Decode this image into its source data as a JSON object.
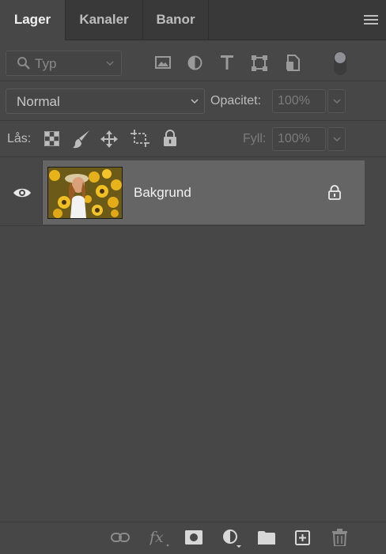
{
  "tabs": [
    {
      "label": "Lager",
      "active": true
    },
    {
      "label": "Kanaler",
      "active": false
    },
    {
      "label": "Banor",
      "active": false
    }
  ],
  "filter": {
    "kind_label": "Typ",
    "icons": [
      "image-filter-icon",
      "adjustment-filter-icon",
      "text-filter-icon",
      "shape-filter-icon",
      "smart-object-filter-icon"
    ]
  },
  "blend": {
    "mode": "Normal",
    "opacity_label": "Opacitet:",
    "opacity_value": "100%"
  },
  "lock": {
    "label": "Lås:",
    "fill_label": "Fyll:",
    "fill_value": "100%"
  },
  "layers": [
    {
      "name": "Bakgrund",
      "visible": true,
      "locked": true
    }
  ],
  "bottom_actions": [
    "link-layers-icon",
    "fx-icon",
    "add-mask-icon",
    "new-fill-adjustment-icon",
    "new-group-icon",
    "new-layer-icon",
    "delete-layer-icon"
  ],
  "colors": {
    "panel_bg": "#474747",
    "tab_bg": "#393939",
    "selected_layer_bg": "#656565",
    "text": "#cfcfcf"
  }
}
